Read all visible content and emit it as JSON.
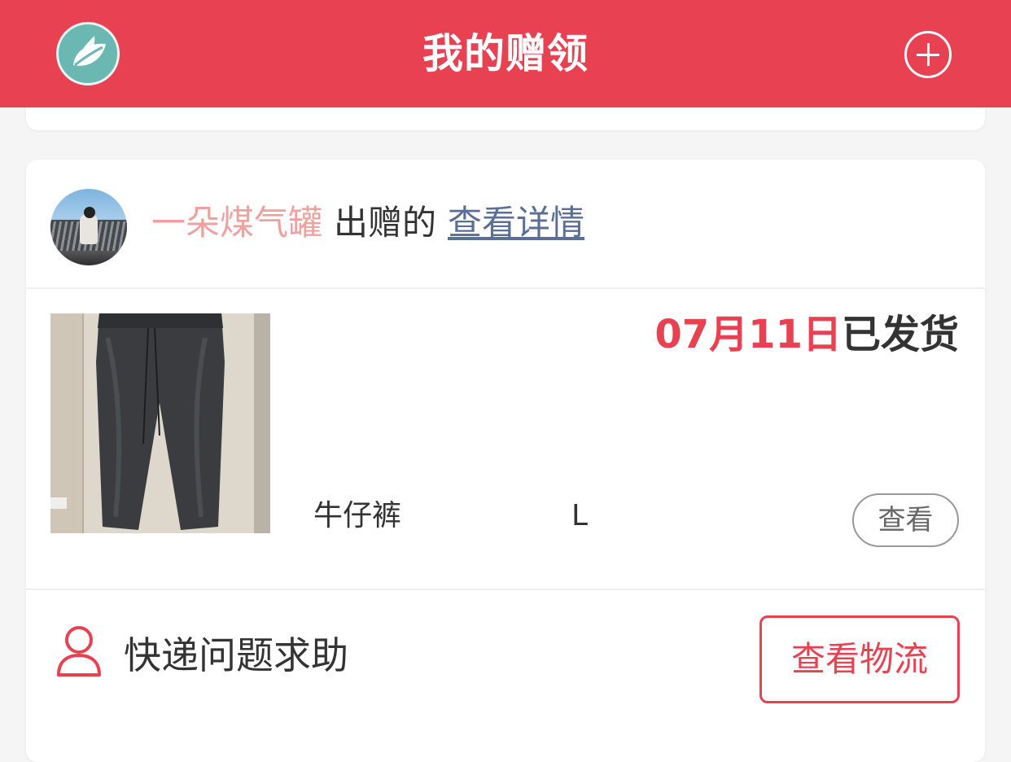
{
  "header": {
    "title": "我的赠领",
    "logo_icon": "leaf-logo-icon",
    "add_icon": "plus-circle-icon",
    "background_color": "#e84152"
  },
  "order": {
    "donor": {
      "name": "一朵煤气罐",
      "verb": "出赠的",
      "detail_link": "查看详情"
    },
    "item": {
      "shipped_date": "07月11日",
      "shipped_status": "已发货",
      "name": "牛仔裤",
      "size": "L",
      "view_button": "查看"
    },
    "help": {
      "icon": "person-icon",
      "label": "快递问题求助",
      "logistics_button": "查看物流"
    }
  },
  "colors": {
    "accent": "#e84152",
    "donor_name": "#f0a09f",
    "link": "#5a6e96"
  }
}
